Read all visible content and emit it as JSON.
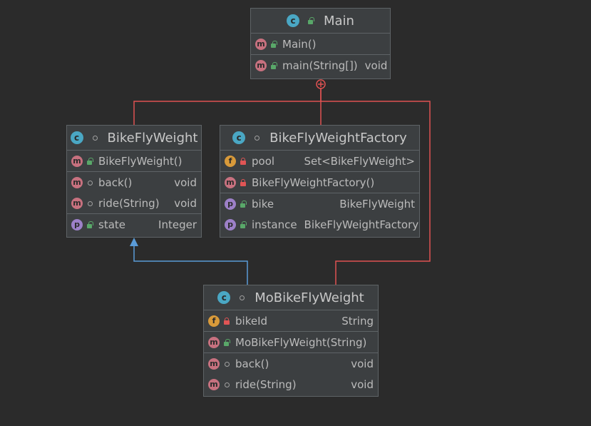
{
  "classes": [
    {
      "id": "main",
      "name": "Main",
      "kind": "c",
      "visibility": "public",
      "sections": [
        [
          {
            "kind": "m",
            "visibility": "public",
            "name": "Main()",
            "type": ""
          }
        ],
        [
          {
            "kind": "m",
            "visibility": "public",
            "name": "main(String[])",
            "type": "void"
          }
        ]
      ]
    },
    {
      "id": "bikeflyweight",
      "name": "BikeFlyWeight",
      "kind": "c",
      "visibility": "package",
      "sections": [
        [
          {
            "kind": "m",
            "visibility": "public",
            "name": "BikeFlyWeight()",
            "type": ""
          }
        ],
        [
          {
            "kind": "m",
            "visibility": "package",
            "name": "back()",
            "type": "void"
          },
          {
            "kind": "m",
            "visibility": "package",
            "name": "ride(String)",
            "type": "void"
          }
        ],
        [
          {
            "kind": "p",
            "visibility": "public",
            "name": "state",
            "type": "Integer"
          }
        ]
      ]
    },
    {
      "id": "factory",
      "name": "BikeFlyWeightFactory",
      "kind": "c",
      "visibility": "package",
      "sections": [
        [
          {
            "kind": "f",
            "visibility": "private",
            "name": "pool",
            "type": "Set<BikeFlyWeight>"
          }
        ],
        [
          {
            "kind": "m",
            "visibility": "private",
            "name": "BikeFlyWeightFactory()",
            "type": ""
          }
        ],
        [
          {
            "kind": "p",
            "visibility": "public",
            "name": "bike",
            "type": "BikeFlyWeight"
          },
          {
            "kind": "p",
            "visibility": "public",
            "name": "instance",
            "type": "BikeFlyWeightFactory"
          }
        ]
      ]
    },
    {
      "id": "mobike",
      "name": "MoBikeFlyWeight",
      "kind": "c",
      "visibility": "package",
      "sections": [
        [
          {
            "kind": "f",
            "visibility": "private",
            "name": "bikeId",
            "type": "String"
          }
        ],
        [
          {
            "kind": "m",
            "visibility": "public",
            "name": "MoBikeFlyWeight(String)",
            "type": ""
          }
        ],
        [
          {
            "kind": "m",
            "visibility": "package",
            "name": "back()",
            "type": "void"
          },
          {
            "kind": "m",
            "visibility": "package",
            "name": "ride(String)",
            "type": "void"
          }
        ]
      ]
    }
  ],
  "relations": [
    {
      "type": "inner-class",
      "from": "main",
      "to": "bikeflyweight",
      "color": "#e05252"
    },
    {
      "type": "inner-class",
      "from": "main",
      "to": "factory",
      "color": "#e05252"
    },
    {
      "type": "inner-class",
      "from": "main",
      "to": "mobike",
      "color": "#e05252"
    },
    {
      "type": "extends",
      "from": "mobike",
      "to": "bikeflyweight",
      "color": "#5a9bd8"
    }
  ],
  "kind_letters": {
    "m": "m",
    "f": "f",
    "p": "p",
    "c": "c"
  }
}
